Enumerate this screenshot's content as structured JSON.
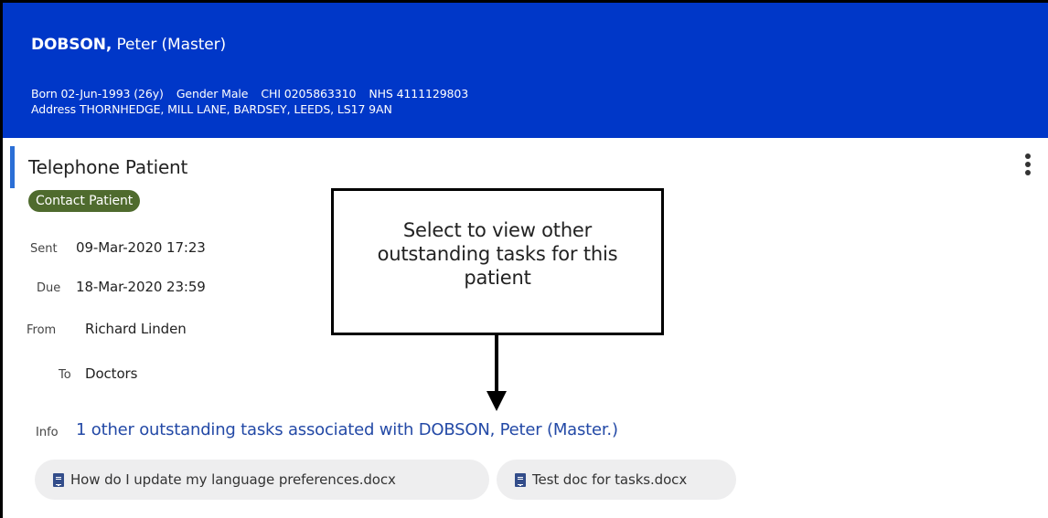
{
  "patient": {
    "surname": "DOBSON,",
    "rest_of_name": " Peter (Master)",
    "details_line1": "Born 02-Jun-1993 (26y)",
    "gender": "Gender Male",
    "chi": "CHI 0205863310",
    "nhs": "NHS 4111129803",
    "address": "Address THORNHEDGE,   MILL LANE, BARDSEY, LEEDS, LS17 9AN"
  },
  "task": {
    "title": "Telephone Patient",
    "status": "Contact Patient",
    "sent_label": "Sent",
    "sent_value": "09-Mar-2020 17:23",
    "due_label": "Due",
    "due_value": "18-Mar-2020 23:59",
    "from_label": "From",
    "from_value": "Richard Linden",
    "to_label": "To",
    "to_value": "Doctors",
    "info_label": "Info",
    "info_link": "1 other outstanding tasks associated with DOBSON, Peter (Master.)"
  },
  "callout": {
    "text": "Select to view other outstanding tasks for this patient"
  },
  "attachments": [
    {
      "label": "How do I update my language preferences.docx",
      "icon": "document-icon"
    },
    {
      "label": "Test doc for tasks.docx",
      "icon": "document-icon"
    }
  ],
  "icons": {
    "menu": "more-vertical-icon"
  },
  "colors": {
    "banner": "#0037c8",
    "status_pill": "#4f6b2e",
    "link": "#2349a6",
    "accent": "#2b6fd6"
  }
}
